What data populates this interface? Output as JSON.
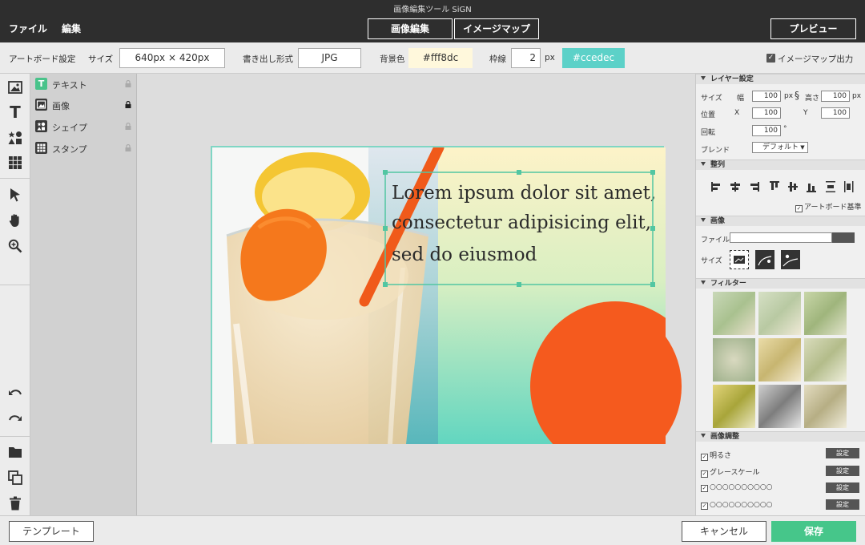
{
  "app": {
    "title": "画像編集ツール SiGN"
  },
  "menu": {
    "file": "ファイル",
    "edit": "編集"
  },
  "mode_tabs": [
    {
      "label": "画像編集",
      "active": true
    },
    {
      "label": "イメージマップ",
      "active": false
    }
  ],
  "preview": {
    "label": "プレビュー"
  },
  "settings": {
    "artboard_label": "アートボード設定",
    "size_label": "サイズ",
    "size_value": "640px × 420px",
    "export_label": "書き出し形式",
    "export_value": "JPG",
    "bg_label": "背景色",
    "bg_value": "#fff8dc",
    "border_label": "枠線",
    "border_width": "2",
    "border_unit": "px",
    "border_color": "#ccedec",
    "imagemap_output_label": "イメージマップ出力",
    "imagemap_output_checked": true
  },
  "tools": {
    "icons": [
      "image-icon",
      "text-icon",
      "shapes-icon",
      "grid-icon",
      "select-arrow-icon",
      "hand-icon",
      "zoom-icon",
      "undo-icon",
      "redo-icon",
      "folder-icon",
      "duplicate-icon",
      "trash-icon"
    ]
  },
  "layers": [
    {
      "label": "テキスト",
      "icon": "text-icon",
      "color": "#49c38a",
      "locked": false
    },
    {
      "label": "画像",
      "icon": "image-icon",
      "color": "#3a3a3a",
      "locked": true
    },
    {
      "label": "シェイプ",
      "icon": "shapes-icon",
      "color": "#3a3a3a",
      "locked": false
    },
    {
      "label": "スタンプ",
      "icon": "grid-icon",
      "color": "#3a3a3a",
      "locked": false
    }
  ],
  "canvas": {
    "text_lines": [
      "Lorem ipsum dolor sit amet,",
      "consectetur adipisicing elit,",
      "sed do eiusmod"
    ],
    "circle_color": "#f55a1e",
    "gradient_top": "#fdf3c8",
    "gradient_bottom": "#62d6c0"
  },
  "panel": {
    "layer_settings": {
      "title": "レイヤー設定",
      "size_label": "サイズ",
      "width_label": "幅",
      "width_value": "100",
      "width_unit": "px",
      "height_label": "高さ",
      "height_value": "100",
      "height_unit": "px",
      "position_label": "位置",
      "x_label": "X",
      "x_value": "100",
      "y_label": "Y",
      "y_value": "100",
      "rotate_label": "回転",
      "rotate_value": "100",
      "rotate_unit": "°",
      "blend_label": "ブレンド",
      "blend_value": "デフォルト"
    },
    "align": {
      "title": "整列",
      "artboard_base_label": "アートボード基準",
      "artboard_base_checked": true
    },
    "image": {
      "title": "画像",
      "file_label": "ファイル",
      "size_label": "サイズ"
    },
    "filter": {
      "title": "フィルター"
    },
    "adjust": {
      "title": "画像調整",
      "items": [
        {
          "label": "明るさ",
          "button": "設定"
        },
        {
          "label": "グレースケール",
          "button": "設定"
        },
        {
          "label": "○○○○○○○○○○",
          "button": "設定"
        },
        {
          "label": "○○○○○○○○○○",
          "button": "設定"
        }
      ]
    }
  },
  "footer": {
    "template": "テンプレート",
    "cancel": "キャンセル",
    "save": "保存"
  }
}
